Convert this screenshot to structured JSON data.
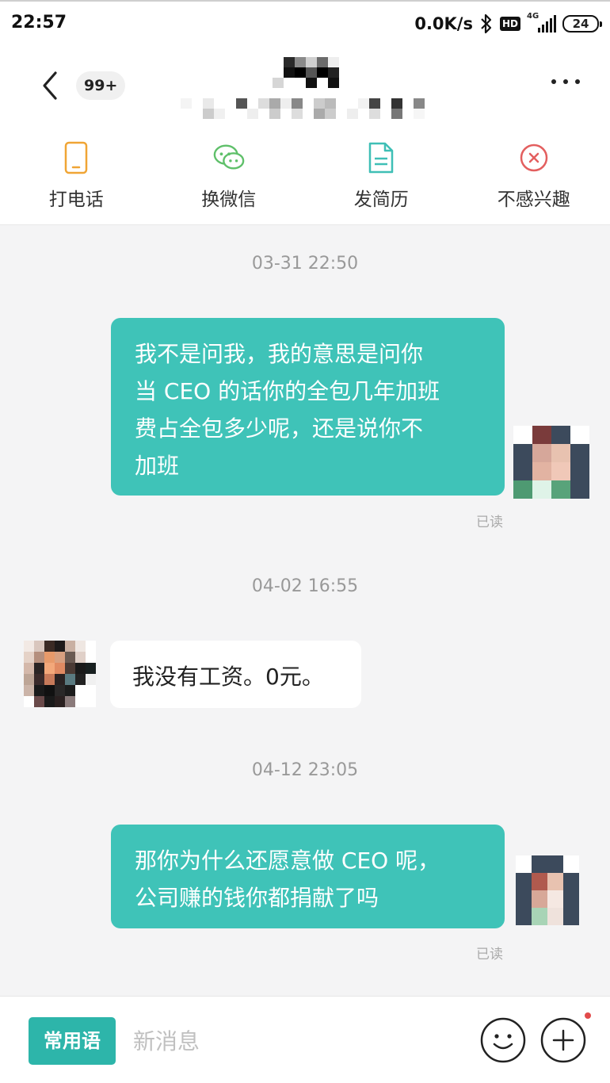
{
  "status_bar": {
    "time": "22:57",
    "net_speed": "0.0K/s",
    "hd": "HD",
    "network": "4G",
    "battery": "24"
  },
  "header": {
    "unread_badge": "99+"
  },
  "actions": [
    {
      "label": "打电话",
      "icon": "phone-icon",
      "color": "#f0a535"
    },
    {
      "label": "换微信",
      "icon": "wechat-icon",
      "color": "#5fc06a"
    },
    {
      "label": "发简历",
      "icon": "resume-icon",
      "color": "#3fbfb6"
    },
    {
      "label": "不感兴趣",
      "icon": "close-circle-icon",
      "color": "#e35f5f"
    }
  ],
  "messages": [
    {
      "type": "time",
      "text": "03-31 22:50"
    },
    {
      "type": "sent",
      "text_lines": [
        "我不是问我，我的意思是问你",
        "当 CEO 的话你的全包几年加班",
        "费占全包多少呢，还是说你不",
        "加班"
      ],
      "status": "已读"
    },
    {
      "type": "time",
      "text": "04-02 16:55"
    },
    {
      "type": "received",
      "text": "我没有工资。0元。"
    },
    {
      "type": "time",
      "text": "04-12 23:05"
    },
    {
      "type": "sent",
      "text_lines": [
        "那你为什么还愿意做 CEO 呢，",
        "公司赚的钱你都捐献了吗"
      ],
      "status": "已读"
    }
  ],
  "input_bar": {
    "phrase_button": "常用语",
    "placeholder": "新消息"
  },
  "colors": {
    "accent": "#3fc3b8",
    "phrase_button": "#2db5aa",
    "background": "#f4f4f5"
  }
}
